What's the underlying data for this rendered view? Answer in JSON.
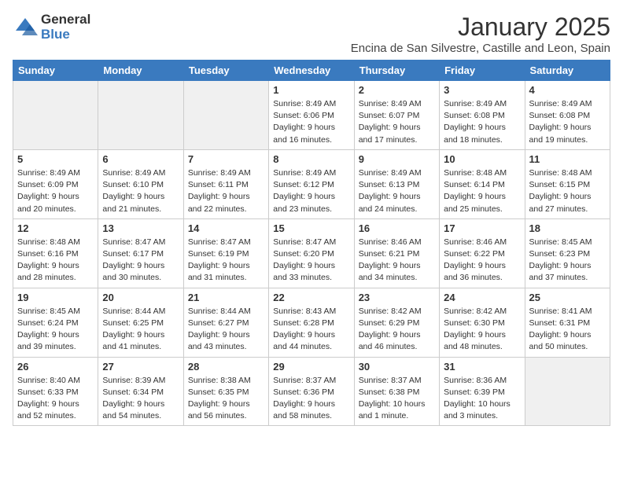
{
  "header": {
    "logo_general": "General",
    "logo_blue": "Blue",
    "month_title": "January 2025",
    "subtitle": "Encina de San Silvestre, Castille and Leon, Spain"
  },
  "weekdays": [
    "Sunday",
    "Monday",
    "Tuesday",
    "Wednesday",
    "Thursday",
    "Friday",
    "Saturday"
  ],
  "weeks": [
    [
      {
        "day": "",
        "info": ""
      },
      {
        "day": "",
        "info": ""
      },
      {
        "day": "",
        "info": ""
      },
      {
        "day": "1",
        "info": "Sunrise: 8:49 AM\nSunset: 6:06 PM\nDaylight: 9 hours and 16 minutes."
      },
      {
        "day": "2",
        "info": "Sunrise: 8:49 AM\nSunset: 6:07 PM\nDaylight: 9 hours and 17 minutes."
      },
      {
        "day": "3",
        "info": "Sunrise: 8:49 AM\nSunset: 6:08 PM\nDaylight: 9 hours and 18 minutes."
      },
      {
        "day": "4",
        "info": "Sunrise: 8:49 AM\nSunset: 6:08 PM\nDaylight: 9 hours and 19 minutes."
      }
    ],
    [
      {
        "day": "5",
        "info": "Sunrise: 8:49 AM\nSunset: 6:09 PM\nDaylight: 9 hours and 20 minutes."
      },
      {
        "day": "6",
        "info": "Sunrise: 8:49 AM\nSunset: 6:10 PM\nDaylight: 9 hours and 21 minutes."
      },
      {
        "day": "7",
        "info": "Sunrise: 8:49 AM\nSunset: 6:11 PM\nDaylight: 9 hours and 22 minutes."
      },
      {
        "day": "8",
        "info": "Sunrise: 8:49 AM\nSunset: 6:12 PM\nDaylight: 9 hours and 23 minutes."
      },
      {
        "day": "9",
        "info": "Sunrise: 8:49 AM\nSunset: 6:13 PM\nDaylight: 9 hours and 24 minutes."
      },
      {
        "day": "10",
        "info": "Sunrise: 8:48 AM\nSunset: 6:14 PM\nDaylight: 9 hours and 25 minutes."
      },
      {
        "day": "11",
        "info": "Sunrise: 8:48 AM\nSunset: 6:15 PM\nDaylight: 9 hours and 27 minutes."
      }
    ],
    [
      {
        "day": "12",
        "info": "Sunrise: 8:48 AM\nSunset: 6:16 PM\nDaylight: 9 hours and 28 minutes."
      },
      {
        "day": "13",
        "info": "Sunrise: 8:47 AM\nSunset: 6:17 PM\nDaylight: 9 hours and 30 minutes."
      },
      {
        "day": "14",
        "info": "Sunrise: 8:47 AM\nSunset: 6:19 PM\nDaylight: 9 hours and 31 minutes."
      },
      {
        "day": "15",
        "info": "Sunrise: 8:47 AM\nSunset: 6:20 PM\nDaylight: 9 hours and 33 minutes."
      },
      {
        "day": "16",
        "info": "Sunrise: 8:46 AM\nSunset: 6:21 PM\nDaylight: 9 hours and 34 minutes."
      },
      {
        "day": "17",
        "info": "Sunrise: 8:46 AM\nSunset: 6:22 PM\nDaylight: 9 hours and 36 minutes."
      },
      {
        "day": "18",
        "info": "Sunrise: 8:45 AM\nSunset: 6:23 PM\nDaylight: 9 hours and 37 minutes."
      }
    ],
    [
      {
        "day": "19",
        "info": "Sunrise: 8:45 AM\nSunset: 6:24 PM\nDaylight: 9 hours and 39 minutes."
      },
      {
        "day": "20",
        "info": "Sunrise: 8:44 AM\nSunset: 6:25 PM\nDaylight: 9 hours and 41 minutes."
      },
      {
        "day": "21",
        "info": "Sunrise: 8:44 AM\nSunset: 6:27 PM\nDaylight: 9 hours and 43 minutes."
      },
      {
        "day": "22",
        "info": "Sunrise: 8:43 AM\nSunset: 6:28 PM\nDaylight: 9 hours and 44 minutes."
      },
      {
        "day": "23",
        "info": "Sunrise: 8:42 AM\nSunset: 6:29 PM\nDaylight: 9 hours and 46 minutes."
      },
      {
        "day": "24",
        "info": "Sunrise: 8:42 AM\nSunset: 6:30 PM\nDaylight: 9 hours and 48 minutes."
      },
      {
        "day": "25",
        "info": "Sunrise: 8:41 AM\nSunset: 6:31 PM\nDaylight: 9 hours and 50 minutes."
      }
    ],
    [
      {
        "day": "26",
        "info": "Sunrise: 8:40 AM\nSunset: 6:33 PM\nDaylight: 9 hours and 52 minutes."
      },
      {
        "day": "27",
        "info": "Sunrise: 8:39 AM\nSunset: 6:34 PM\nDaylight: 9 hours and 54 minutes."
      },
      {
        "day": "28",
        "info": "Sunrise: 8:38 AM\nSunset: 6:35 PM\nDaylight: 9 hours and 56 minutes."
      },
      {
        "day": "29",
        "info": "Sunrise: 8:37 AM\nSunset: 6:36 PM\nDaylight: 9 hours and 58 minutes."
      },
      {
        "day": "30",
        "info": "Sunrise: 8:37 AM\nSunset: 6:38 PM\nDaylight: 10 hours and 1 minute."
      },
      {
        "day": "31",
        "info": "Sunrise: 8:36 AM\nSunset: 6:39 PM\nDaylight: 10 hours and 3 minutes."
      },
      {
        "day": "",
        "info": ""
      }
    ]
  ]
}
